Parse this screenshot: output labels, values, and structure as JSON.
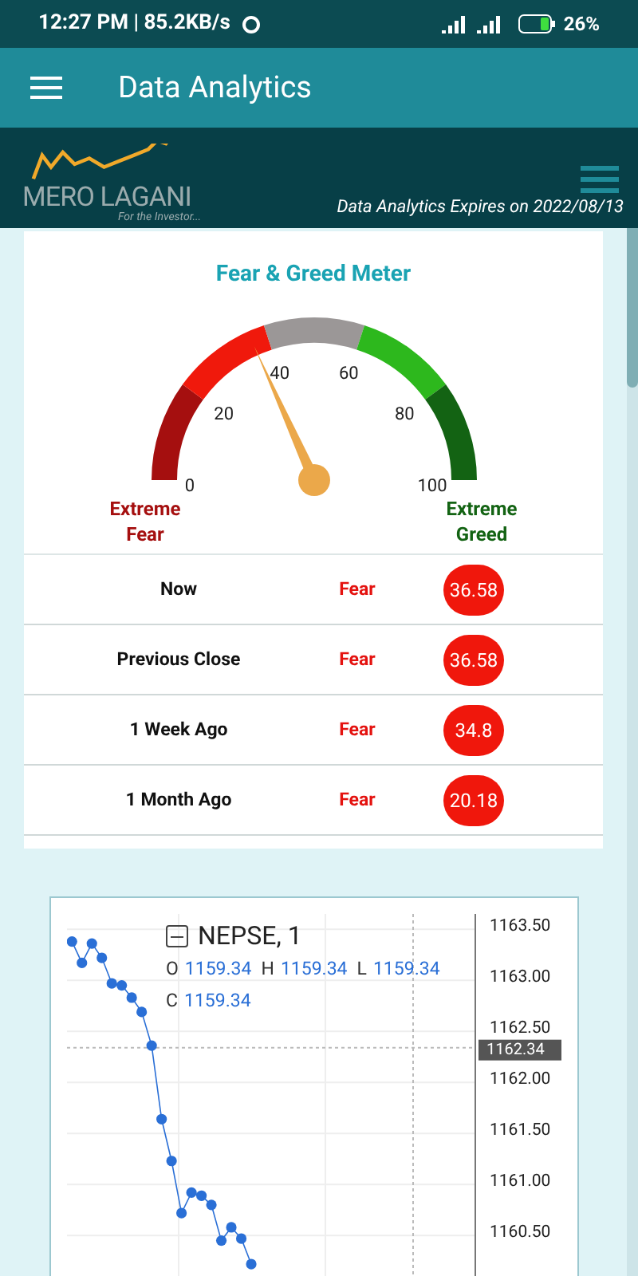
{
  "status_bar": {
    "time": "12:27 PM | 85.2KB/s",
    "battery": "26%"
  },
  "app_bar": {
    "title": "Data Analytics"
  },
  "banner": {
    "logo_text": "MERO LAGANI",
    "tagline": "For the Investor...",
    "expiry": "Data Analytics Expires on 2022/08/13"
  },
  "meter": {
    "title": "Fear & Greed Meter",
    "scale": [
      "0",
      "20",
      "40",
      "60",
      "80",
      "100"
    ],
    "left_label": "Extreme Fear",
    "right_label": "Extreme Greed",
    "rows": [
      {
        "label": "Now",
        "status": "Fear",
        "value": "36.58"
      },
      {
        "label": "Previous Close",
        "status": "Fear",
        "value": "36.58"
      },
      {
        "label": "1 Week Ago",
        "status": "Fear",
        "value": "34.8"
      },
      {
        "label": "1 Month Ago",
        "status": "Fear",
        "value": "20.18"
      }
    ]
  },
  "chart": {
    "ohlc": [
      {
        "key": "O",
        "value": "1159.34"
      },
      {
        "key": "H",
        "value": "1159.34"
      },
      {
        "key": "L",
        "value": "1159.34"
      },
      {
        "key": "C",
        "value": "1159.34"
      }
    ],
    "chart_data": {
      "type": "line",
      "grid": true,
      "categories": [
        null,
        null,
        null,
        null,
        null,
        null,
        null,
        null,
        null,
        null,
        null,
        null,
        null,
        null,
        null,
        null,
        null,
        null,
        null,
        null,
        null,
        null,
        null,
        null,
        null,
        null,
        null,
        null,
        null,
        null,
        null,
        null,
        null,
        null,
        null,
        null,
        null,
        null,
        null,
        null,
        null
      ],
      "ylim": [
        1159.9,
        1163.65
      ],
      "yticks": [
        {
          "value": 1163.5,
          "label": "1163.50"
        },
        {
          "value": 1163,
          "label": "1163.00"
        },
        {
          "value": 1162.5,
          "label": "1162.50"
        },
        {
          "value": 1162,
          "label": "1162.00"
        },
        {
          "value": 1161.5,
          "label": "1161.50"
        },
        {
          "value": 1161,
          "label": "1161.00"
        },
        {
          "value": 1160.5,
          "label": "1160.50"
        }
      ],
      "ref_lines": [
        {
          "axis": "y",
          "value": 1162.34,
          "label": "1162.34"
        }
      ],
      "series": [
        {
          "name": "NEPSE, 1",
          "color": "#2a6fd6",
          "marker": "circle",
          "values": [
            1163.38,
            1163.17,
            1163.36,
            1163.22,
            1162.97,
            1162.95,
            1162.83,
            1162.69,
            1162.36,
            1161.64,
            1161.23,
            1160.72,
            1160.92,
            1160.89,
            1160.8,
            1160.45,
            1160.58,
            1160.47,
            1160.22,
            null,
            null,
            null,
            null,
            null,
            null,
            null,
            null,
            null,
            null,
            null,
            null,
            null,
            null,
            null,
            null,
            null,
            null,
            null,
            null,
            null,
            null
          ]
        }
      ]
    }
  }
}
